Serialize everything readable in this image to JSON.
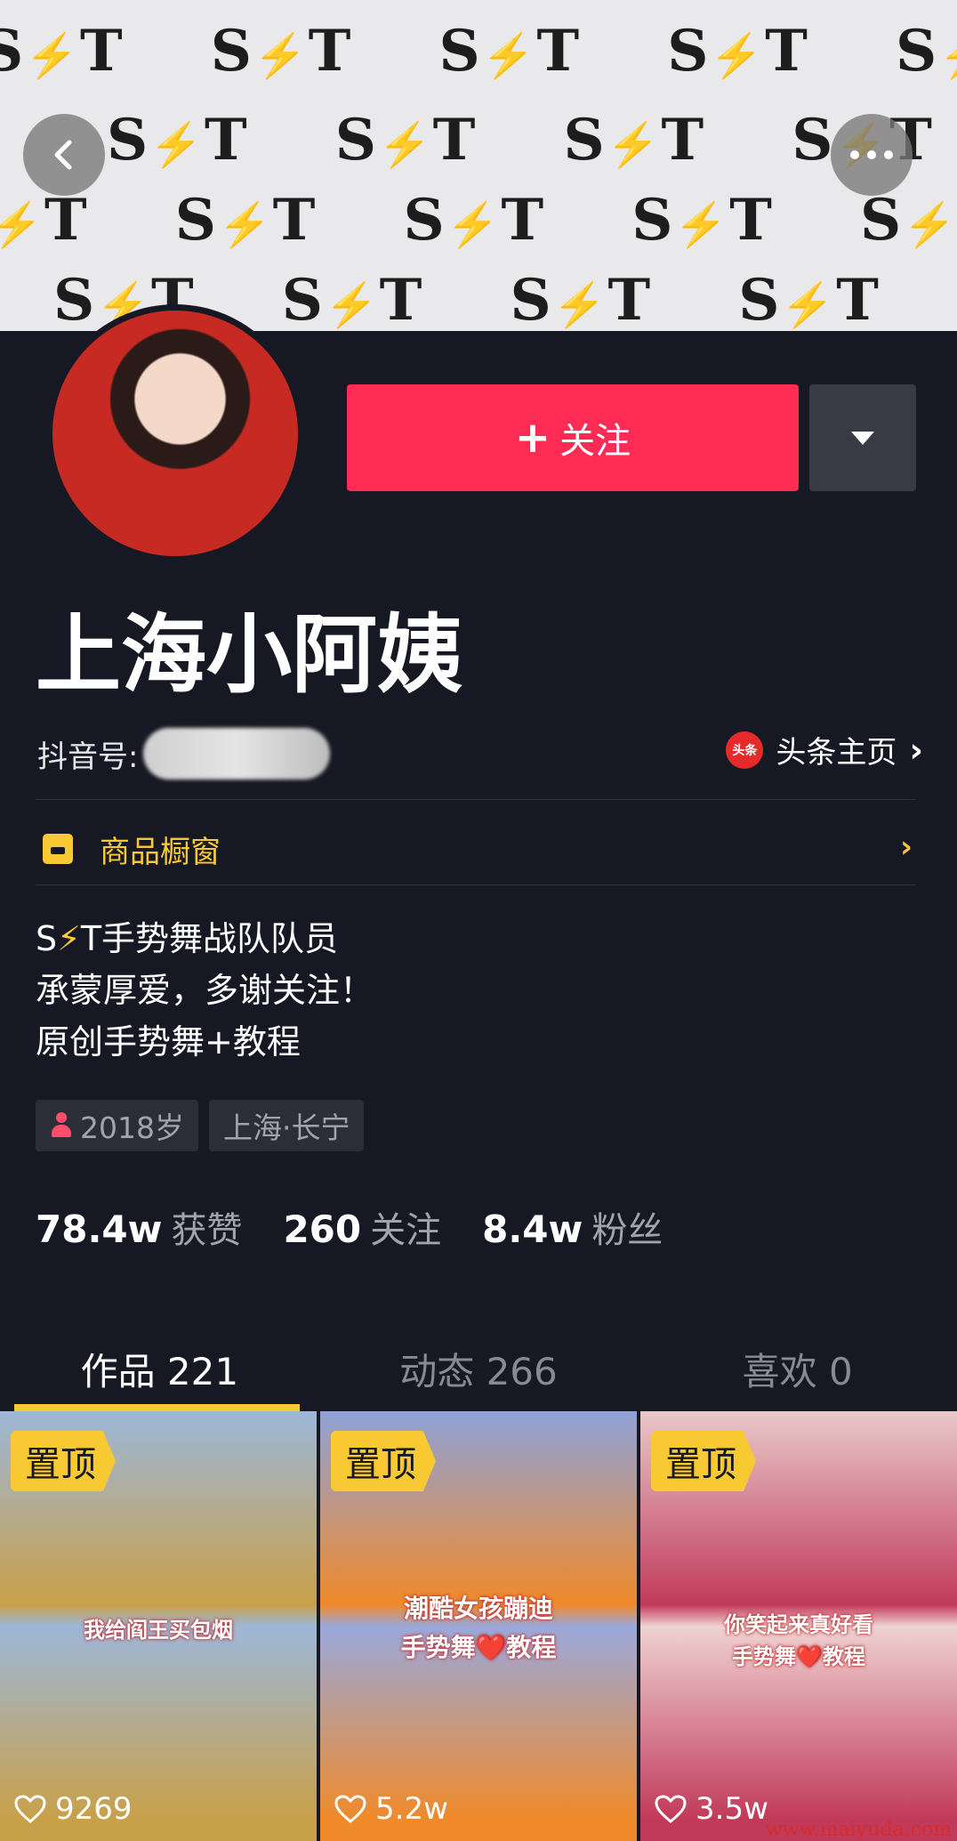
{
  "banner": {
    "pattern_text": "S",
    "pattern_text_2": "T",
    "bolt": "⚡"
  },
  "header": {
    "back_icon": "chevron-left-icon",
    "more_icon": "more-dots-icon"
  },
  "profile": {
    "username": "上海小阿姨",
    "douyin_id_label": "抖音号:",
    "toutiao_logo_text": "头条",
    "toutiao_label": "头条主页",
    "follow_label": "关注",
    "follow_plus": "+"
  },
  "shop": {
    "label": "商品橱窗"
  },
  "bio": {
    "line1_pre": "S",
    "line1_bolt": "⚡",
    "line1_post": "T手势舞战队队员",
    "line2": "承蒙厚爱，多谢关注！",
    "line3": "原创手势舞+教程"
  },
  "tags": {
    "age": "2018岁",
    "location": "上海·长宁"
  },
  "stats": {
    "likes_num": "78.4w",
    "likes_label": "获赞",
    "following_num": "260",
    "following_label": "关注",
    "fans_num": "8.4w",
    "fans_label": "粉丝"
  },
  "tabs": [
    {
      "label": "作品 221",
      "active": true
    },
    {
      "label": "动态 266",
      "active": false
    },
    {
      "label": "喜欢 0",
      "active": false
    }
  ],
  "videos": [
    {
      "pin": "置顶",
      "caption": "我给阎王买包烟",
      "likes": "9269"
    },
    {
      "pin": "置顶",
      "caption1": "潮酷女孩蹦迪",
      "caption2": "手势舞❤️教程",
      "likes": "5.2w"
    },
    {
      "pin": "置顶",
      "caption1": "你笑起来真好看",
      "caption2": "手势舞❤️教程",
      "likes": "3.5w"
    }
  ],
  "watermark": "www.maiyuda.com",
  "colors": {
    "accent": "#fe2c55",
    "yellow": "#f8c932",
    "background": "#161823"
  }
}
